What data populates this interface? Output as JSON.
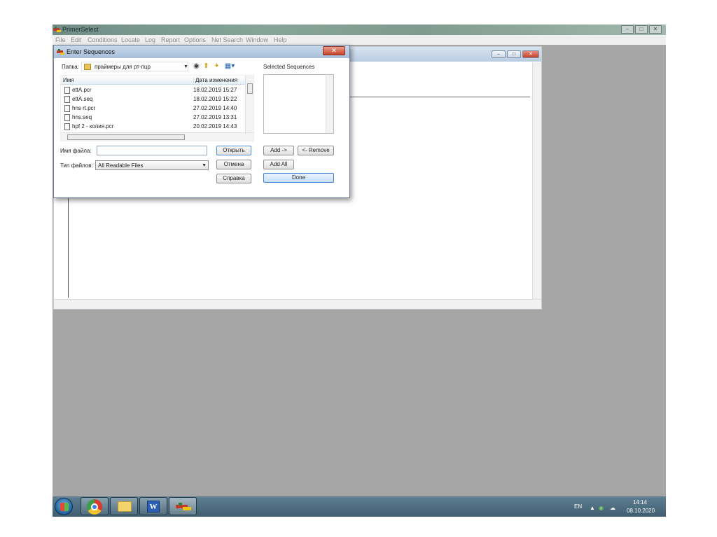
{
  "app": {
    "title": "PrimerSelect",
    "menu": [
      "File",
      "Edit",
      "Conditions",
      "Locate",
      "Log",
      "Report",
      "Options",
      "Net Search",
      "Window",
      "Help"
    ],
    "window_buttons": [
      "–",
      "□",
      "✕"
    ]
  },
  "editor": {
    "window_buttons": [
      "–",
      "□",
      "✕"
    ]
  },
  "dialog": {
    "title": "Enter Sequences",
    "close_label": "✕",
    "folder_label": "Папка:",
    "folder_value": "праймеры для рт-пцр",
    "columns": {
      "name": "Имя",
      "date": "Дата изменения"
    },
    "files": [
      {
        "name": "ettA.pcr",
        "date": "18.02.2019 15:27"
      },
      {
        "name": "ettA.seq",
        "date": "18.02.2019 15:22"
      },
      {
        "name": "hns rt.pcr",
        "date": "27.02.2019 14:40"
      },
      {
        "name": "hns.seq",
        "date": "27.02.2019 13:31"
      },
      {
        "name": "hpf 2 - копия.pcr",
        "date": "20.02.2019 14:43"
      }
    ],
    "filename_label": "Имя файла:",
    "filename_value": "",
    "filetype_label": "Тип файлов:",
    "filetype_value": "All Readable Files",
    "buttons": {
      "open": "Открыть",
      "cancel": "Отмена",
      "help": "Справка"
    },
    "selected_label": "Selected Sequences",
    "selected_buttons": {
      "add": "Add ->",
      "remove": "<- Remove",
      "add_all": "Add All",
      "done": "Done"
    }
  },
  "taskbar": {
    "language": "EN",
    "time": "14:14",
    "date": "08.10.2020"
  }
}
